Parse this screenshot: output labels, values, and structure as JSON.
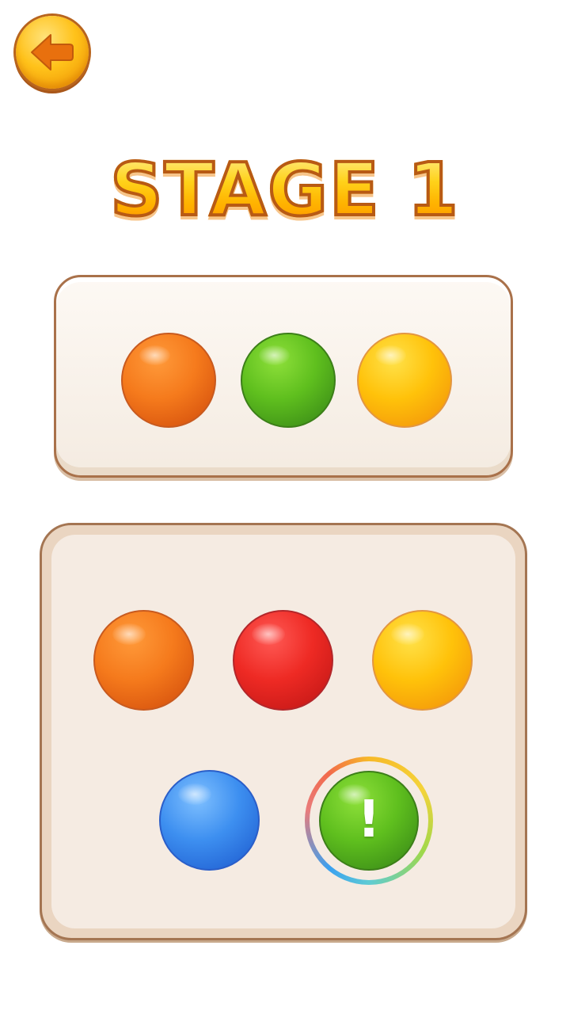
{
  "header": {
    "back_button_icon": "back-arrow-icon"
  },
  "title": "STAGE 1",
  "target_sequence": [
    {
      "color": "orange",
      "hex": "#f57a1c"
    },
    {
      "color": "green",
      "hex": "#5fbf1e"
    },
    {
      "color": "yellow",
      "hex": "#ffc20a"
    }
  ],
  "choices": [
    {
      "color": "orange",
      "hex": "#f57a1c"
    },
    {
      "color": "red",
      "hex": "#ee2a24"
    },
    {
      "color": "yellow",
      "hex": "#ffc20a"
    },
    {
      "color": "blue",
      "hex": "#3d8ff0"
    },
    {
      "color": "green",
      "hex": "#5fbf1e",
      "hint": true
    }
  ],
  "hint_mark": "!",
  "colors": {
    "accent": "#ffc21a",
    "panel_border": "#a47552"
  }
}
